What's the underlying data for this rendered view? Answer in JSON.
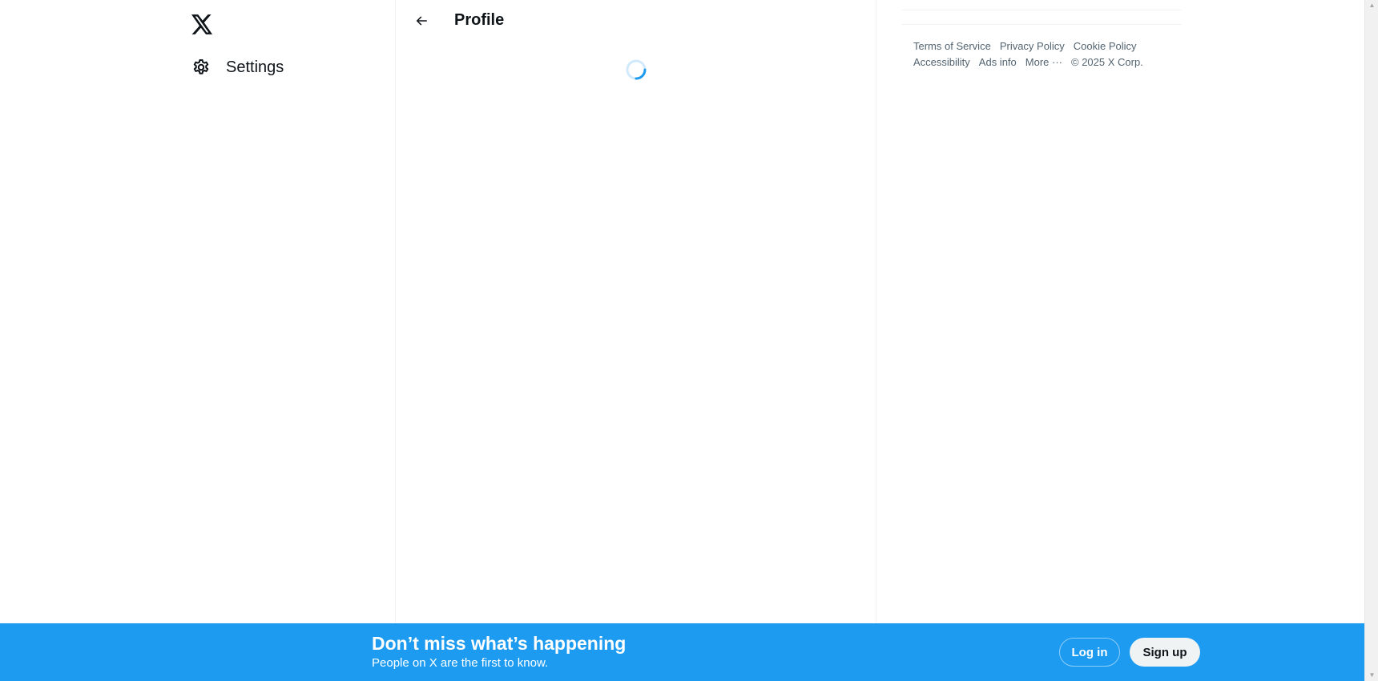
{
  "nav": {
    "logo": "x-logo-icon",
    "items": [
      {
        "label": "Settings",
        "icon": "gear-icon"
      }
    ]
  },
  "main": {
    "back_icon": "arrow-left-icon",
    "title": "Profile",
    "loading": true
  },
  "sidebar": {
    "footer_links": [
      "Terms of Service",
      "Privacy Policy",
      "Cookie Policy",
      "Accessibility",
      "Ads info",
      "More ···"
    ],
    "copyright": "© 2025 X Corp."
  },
  "banner": {
    "title": "Don’t miss what’s happening",
    "subtitle": "People on X are the first to know.",
    "login_label": "Log in",
    "signup_label": "Sign up"
  },
  "colors": {
    "accent": "#1d9bf0",
    "text": "#0f1419",
    "muted": "#536471",
    "border": "#eff3f4"
  }
}
